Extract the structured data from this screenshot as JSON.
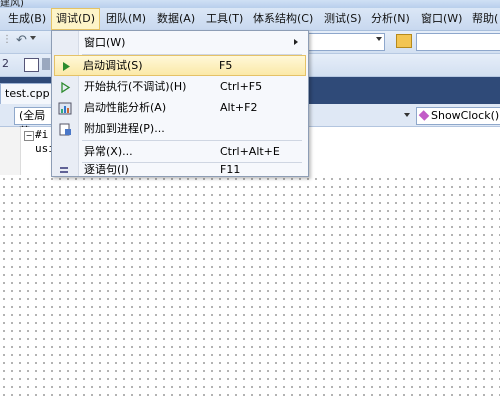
{
  "title_fragment": "建风)",
  "menubar": {
    "items": [
      "生成(B)",
      "调试(D)",
      "团队(M)",
      "数据(A)",
      "工具(T)",
      "体系结构(C)",
      "测试(S)",
      "分析(N)",
      "窗口(W)",
      "帮助("
    ],
    "active_index": 1
  },
  "tab": {
    "label": "test.cpp"
  },
  "scope": {
    "left": "(全局范",
    "right": "ShowClock()"
  },
  "code": {
    "line1": "#i",
    "line2": "usi"
  },
  "debug_menu": {
    "items": [
      {
        "label": "窗口(W)",
        "shortcut": "",
        "icon": "none",
        "submenu": true
      },
      {
        "label": "启动调试(S)",
        "shortcut": "F5",
        "icon": "play-icon",
        "highlighted": true
      },
      {
        "label": "开始执行(不调试)(H)",
        "shortcut": "Ctrl+F5",
        "icon": "play-outline-icon"
      },
      {
        "label": "启动性能分析(A)",
        "shortcut": "Alt+F2",
        "icon": "performance-icon"
      },
      {
        "label": "附加到进程(P)...",
        "shortcut": "",
        "icon": "attach-icon"
      },
      {
        "label": "异常(X)...",
        "shortcut": "Ctrl+Alt+E",
        "icon": "none"
      },
      {
        "label": "逐语句(I)",
        "shortcut": "F11",
        "icon": "step-into-icon"
      }
    ]
  },
  "colors": {
    "highlight": "#fbe9a8",
    "tabstrip": "#2f4a78",
    "menubar": "#c8d8ef"
  }
}
